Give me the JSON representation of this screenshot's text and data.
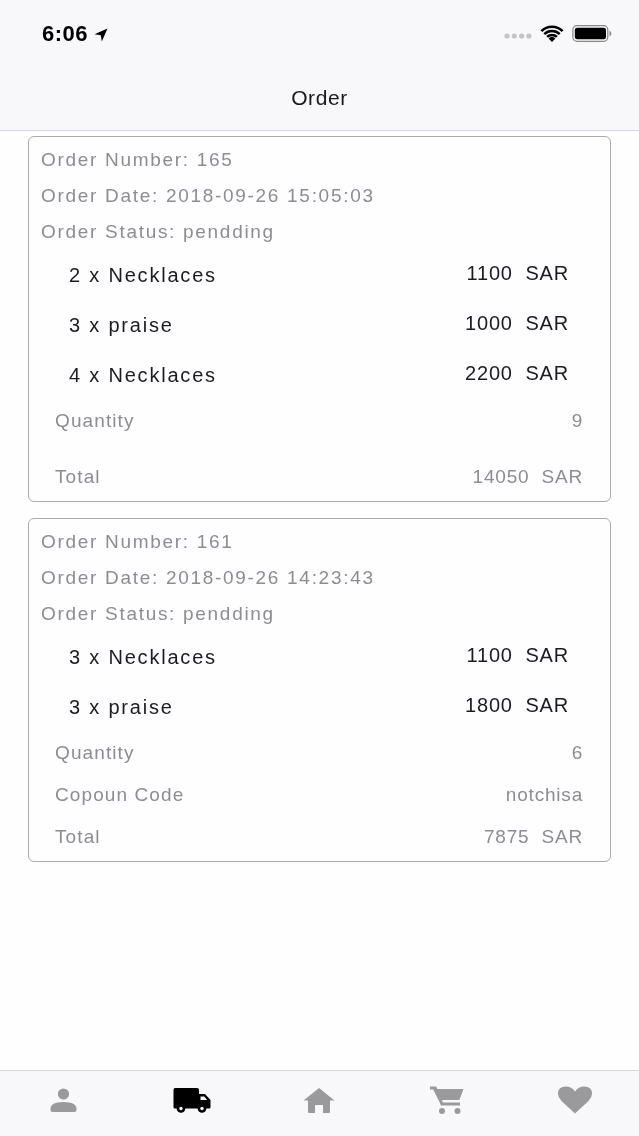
{
  "status_bar": {
    "time": "6:06"
  },
  "nav_bar": {
    "title": "Order"
  },
  "orders": [
    {
      "header_lines": [
        "Order Number: 165",
        "Order Date: 2018-09-26 15:05:03",
        "Order Status: pendding"
      ],
      "items": [
        {
          "name": "2 x Necklaces",
          "price": "1100  SAR"
        },
        {
          "name": "3 x praise",
          "price": "1000  SAR"
        },
        {
          "name": "4 x Necklaces",
          "price": "2200  SAR"
        }
      ],
      "summary": [
        {
          "label": "Quantity",
          "value": "9"
        },
        {
          "label": "Total",
          "value": "14050  SAR"
        }
      ]
    },
    {
      "header_lines": [
        "Order Number: 161",
        "Order Date: 2018-09-26 14:23:43",
        "Order Status: pendding"
      ],
      "items": [
        {
          "name": "3 x Necklaces",
          "price": "1100  SAR"
        },
        {
          "name": "3 x praise",
          "price": "1800  SAR"
        }
      ],
      "summary": [
        {
          "label": "Quantity",
          "value": "6"
        },
        {
          "label": "Copoun Code",
          "value": "notchisa"
        },
        {
          "label": "Total",
          "value": "7875  SAR"
        }
      ]
    }
  ],
  "tab_bar": {
    "items": [
      {
        "kind": "person",
        "selected": false
      },
      {
        "kind": "truck",
        "selected": true
      },
      {
        "kind": "home",
        "selected": false
      },
      {
        "kind": "cart",
        "selected": false
      },
      {
        "kind": "heart",
        "selected": false
      }
    ]
  }
}
